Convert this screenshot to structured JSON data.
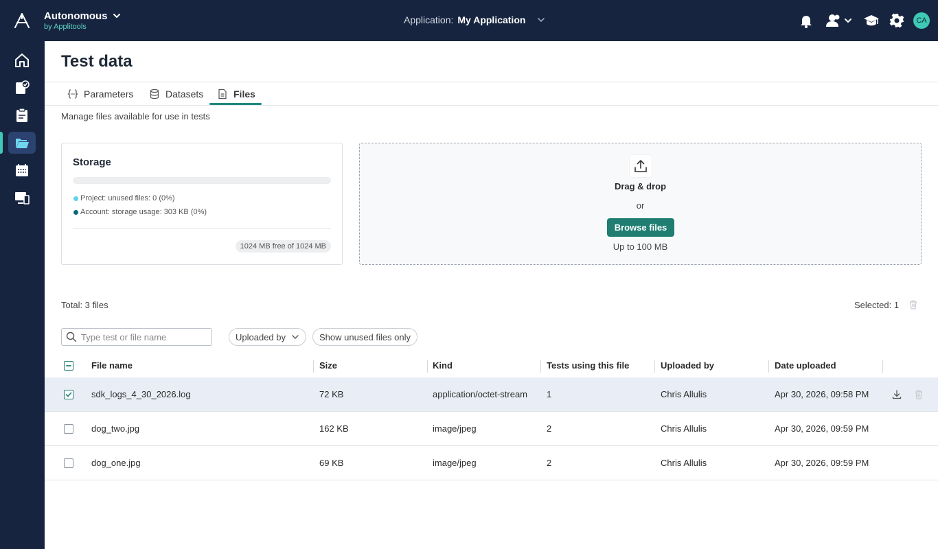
{
  "header": {
    "brand_name": "Autonomous",
    "brand_sub": "by Applitools",
    "app_label": "Application:",
    "app_name": "My Application",
    "user_initials": "CA"
  },
  "sidebar": {
    "items": [
      {
        "name": "home"
      },
      {
        "name": "tests"
      },
      {
        "name": "test-runs"
      },
      {
        "name": "test-data",
        "active": true
      },
      {
        "name": "schedules"
      },
      {
        "name": "environments"
      }
    ]
  },
  "page": {
    "title": "Test data",
    "tabs": [
      {
        "label": "Parameters"
      },
      {
        "label": "Datasets"
      },
      {
        "label": "Files",
        "active": true
      }
    ],
    "subtitle": "Manage files available for use in tests"
  },
  "storage": {
    "title": "Storage",
    "project_legend": "Project: unused files: 0 (0%)",
    "account_legend": "Account: storage usage: 303 KB (0%)",
    "free_label": "1024 MB free of 1024 MB",
    "usage_fraction": 0.0,
    "project_color": "#5fd3e8",
    "account_color": "#0a6b7a"
  },
  "dropzone": {
    "title": "Drag & drop",
    "or": "or",
    "button": "Browse files",
    "limit": "Up to 100 MB"
  },
  "files": {
    "total_label": "Total: 3 files",
    "selected_label": "Selected: 1",
    "search_placeholder": "Type test or file name",
    "filter_uploaded_by": "Uploaded by",
    "filter_unused": "Show unused files only",
    "columns": [
      "File name",
      "Size",
      "Kind",
      "Tests using this file",
      "Uploaded by",
      "Date uploaded"
    ],
    "rows": [
      {
        "name": "sdk_logs_4_30_2026.log",
        "size": "72 KB",
        "kind": "application/octet-stream",
        "tests": "1",
        "uploaded_by": "Chris Allulis",
        "date": "Apr 30, 2026, 09:58 PM",
        "checked": true
      },
      {
        "name": "dog_two.jpg",
        "size": "162 KB",
        "kind": "image/jpeg",
        "tests": "2",
        "uploaded_by": "Chris Allulis",
        "date": "Apr 30, 2026, 09:59 PM",
        "checked": false
      },
      {
        "name": "dog_one.jpg",
        "size": "69 KB",
        "kind": "image/jpeg",
        "tests": "2",
        "uploaded_by": "Chris Allulis",
        "date": "Apr 30, 2026, 09:59 PM",
        "checked": false
      }
    ]
  },
  "colors": {
    "topbar": "#16243f",
    "accent": "#1f7d72",
    "teal": "#3fc8b4"
  }
}
